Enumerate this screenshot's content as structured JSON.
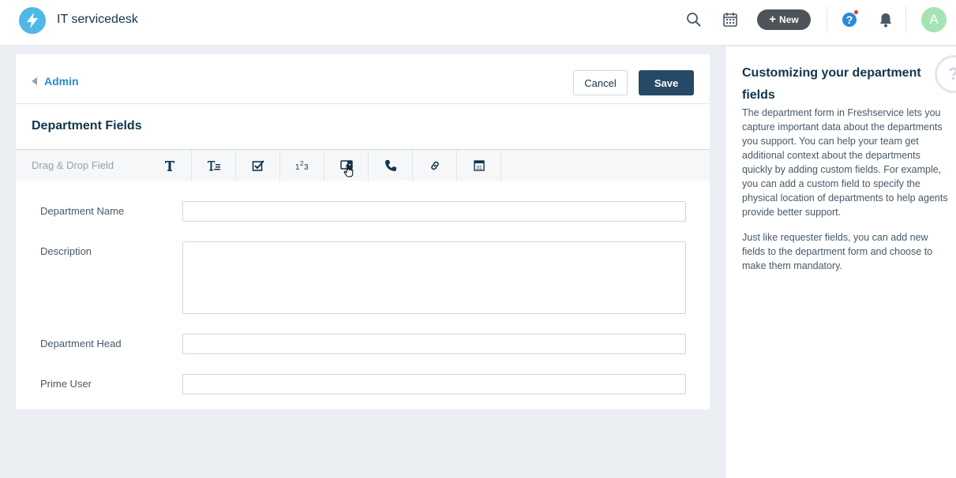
{
  "app": {
    "title": "IT servicedesk"
  },
  "topbar": {
    "new_label": "New",
    "new_icon": "plus-icon",
    "avatar_letter": "A",
    "icons": [
      "search-icon",
      "calendar-icon",
      "help-icon",
      "bell-icon"
    ],
    "colors": {
      "logo": "#4fb8e6",
      "avatar": "#a6e3b4",
      "notification_dot": "#e43538",
      "help": "#2c8ad6"
    }
  },
  "header": {
    "back_label": "Admin",
    "cancel_label": "Cancel",
    "save_label": "Save"
  },
  "section": {
    "title": "Department Fields"
  },
  "field_bar": {
    "label": "Drag & Drop Field",
    "items": [
      "single-line-text-icon",
      "paragraph-icon",
      "checkbox-icon",
      "number-icon",
      "dropdown-icon",
      "phone-icon",
      "url-icon",
      "date-icon"
    ]
  },
  "fields": [
    {
      "label": "Department Name",
      "value": ""
    },
    {
      "label": "Description",
      "value": ""
    },
    {
      "label": "Department Head",
      "value": ""
    },
    {
      "label": "Prime User",
      "value": ""
    }
  ],
  "side": {
    "title": "Customizing your department fields",
    "p1": "The department form in Freshservice lets you capture important data about the departments you support. You can help your team get additional context about the departments quickly by adding custom fields. For example, you can add a custom field to specify the physical location of departments to help agents provide better support.",
    "p2": "Just like requester fields, you can add new fields to the department form and choose to make them mandatory.",
    "help_glyph": "?"
  }
}
